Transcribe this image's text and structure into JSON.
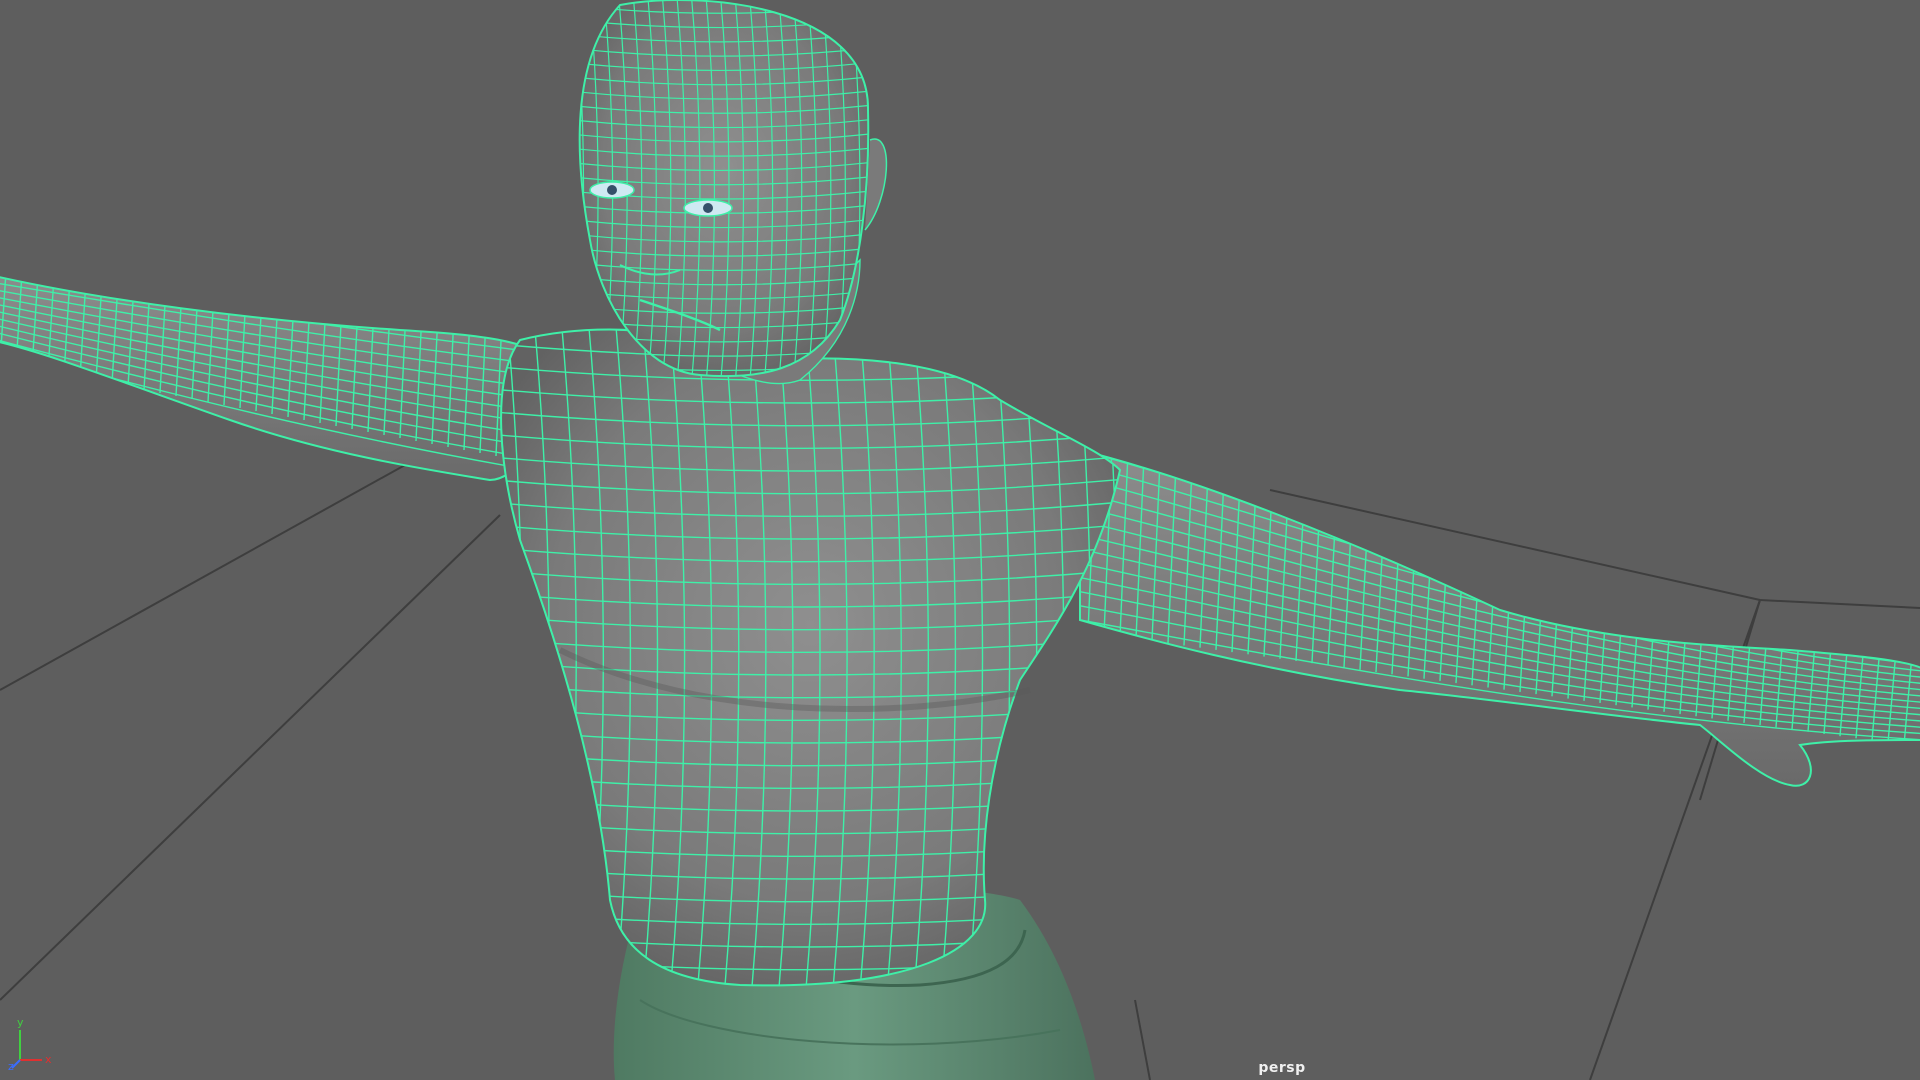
{
  "viewport": {
    "camera_label": "persp",
    "background_color": "#5e5e5e",
    "grid_line_color": "#3e3e3e",
    "wireframe_color": "#3ef0a8",
    "surface_color": "#7e7e7e",
    "pants_color": "#5e8a72"
  },
  "axis_gizmo": {
    "x_label": "x",
    "y_label": "y",
    "z_label": "z",
    "x_color": "#e03030",
    "y_color": "#40d040",
    "z_color": "#3a6cff"
  },
  "model": {
    "icon": "character-mesh-icon",
    "selected": true
  }
}
